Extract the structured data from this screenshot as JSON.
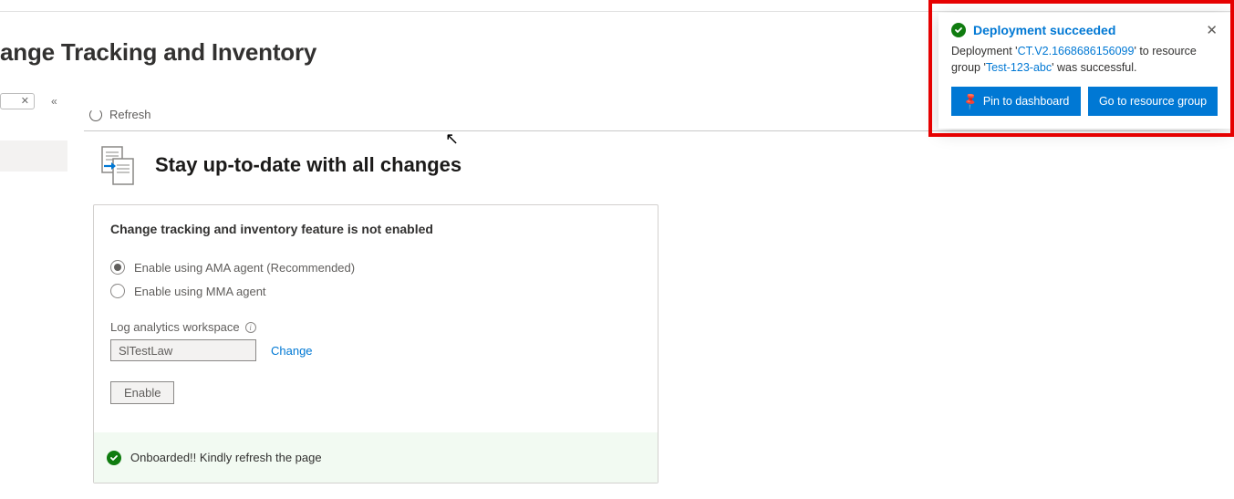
{
  "page": {
    "title": "ange Tracking and Inventory",
    "more_label": "···"
  },
  "toolbar": {
    "refresh_label": "Refresh",
    "collapse_label": "«"
  },
  "heading": "Stay up-to-date with all changes",
  "card": {
    "title": "Change tracking and inventory feature is not enabled",
    "option_ama": "Enable using AMA agent (Recommended)",
    "option_mma": "Enable using MMA agent",
    "workspace_label": "Log analytics workspace",
    "workspace_value": "SlTestLaw",
    "change_link": "Change",
    "enable_btn": "Enable",
    "status_message": "Onboarded!! Kindly refresh the page"
  },
  "toast": {
    "title": "Deployment succeeded",
    "body_prefix": "Deployment '",
    "deployment_name": "CT.V2.1668686156099",
    "body_mid1": "' to resource group '",
    "resource_group": "Test-123-abc",
    "body_suffix": "' was successful.",
    "pin_btn": "Pin to dashboard",
    "go_btn": "Go to resource group"
  }
}
